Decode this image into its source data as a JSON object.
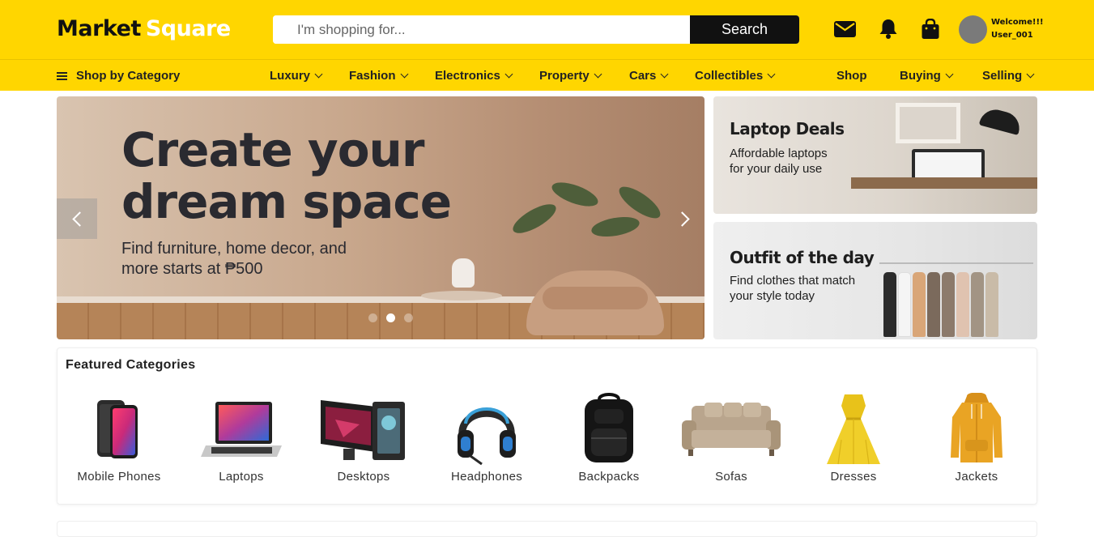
{
  "header": {
    "logo_part1": "Market",
    "logo_part2": "Square",
    "search_placeholder": "I'm shopping for...",
    "search_button": "Search",
    "icons": [
      "mail-icon",
      "bell-icon",
      "shopping-bag-icon"
    ],
    "welcome_line1": "Welcome!!!",
    "welcome_line2": "User_001",
    "brand_color": "#ffd600"
  },
  "nav": {
    "shop_by_category": "Shop by Category",
    "items": [
      {
        "label": "Luxury",
        "dropdown": true
      },
      {
        "label": "Fashion",
        "dropdown": true
      },
      {
        "label": "Electronics",
        "dropdown": true
      },
      {
        "label": "Property",
        "dropdown": true
      },
      {
        "label": "Cars",
        "dropdown": true
      },
      {
        "label": "Collectibles",
        "dropdown": true
      }
    ],
    "right_items": [
      {
        "label": "Shop",
        "dropdown": false
      },
      {
        "label": "Buying",
        "dropdown": true
      },
      {
        "label": "Selling",
        "dropdown": true
      }
    ]
  },
  "hero": {
    "title_line1": "Create your",
    "title_line2": "dream space",
    "subtitle_line1": "Find furniture, home decor, and",
    "subtitle_line2": "more starts at ₱500",
    "slide_count": 3,
    "active_slide": 2
  },
  "promos": [
    {
      "title": "Laptop Deals",
      "line1": "Affordable laptops",
      "line2": "for your daily use"
    },
    {
      "title": "Outfit of the day",
      "line1": "Find clothes that match",
      "line2": "your style today"
    }
  ],
  "featured": {
    "heading": "Featured Categories",
    "categories": [
      {
        "label": "Mobile Phones",
        "icon": "mobile-phone-icon"
      },
      {
        "label": "Laptops",
        "icon": "laptop-icon"
      },
      {
        "label": "Desktops",
        "icon": "desktop-icon"
      },
      {
        "label": "Headphones",
        "icon": "headphones-icon"
      },
      {
        "label": "Backpacks",
        "icon": "backpack-icon"
      },
      {
        "label": "Sofas",
        "icon": "sofa-icon"
      },
      {
        "label": "Dresses",
        "icon": "dress-icon"
      },
      {
        "label": "Jackets",
        "icon": "jacket-icon"
      }
    ]
  }
}
